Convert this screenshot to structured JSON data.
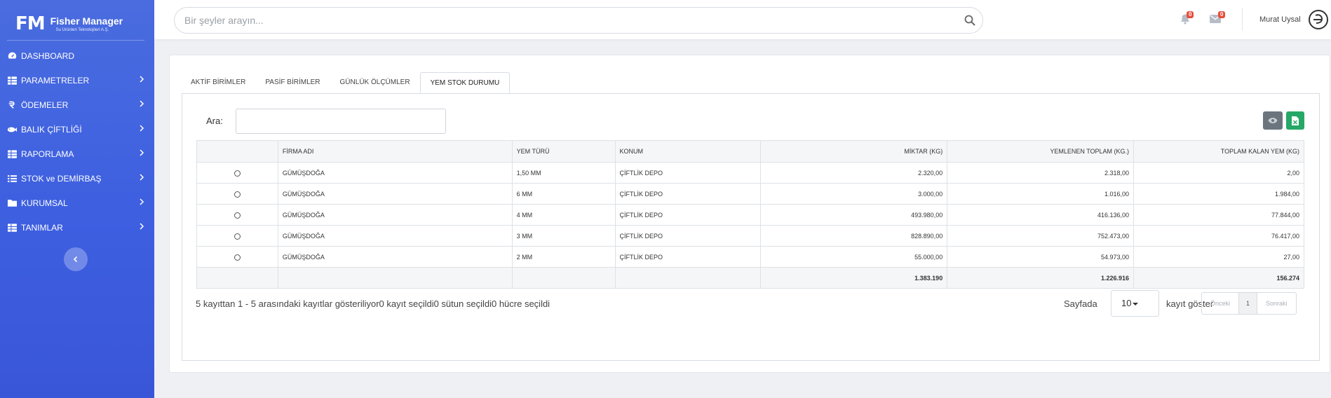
{
  "brand": {
    "logo": "FM",
    "title": "Fisher Manager",
    "subtitle": "Su Ürünleri Teknolojileri A.Ş."
  },
  "sidebar": {
    "items": [
      {
        "label": "DASHBOARD",
        "icon": "dashboard-icon",
        "chevron": false
      },
      {
        "label": "PARAMETRELER",
        "icon": "grid-icon",
        "chevron": true
      },
      {
        "label": "ÖDEMELER",
        "icon": "payment-icon",
        "chevron": true
      },
      {
        "label": "BALIK ÇİFTLİĞİ",
        "icon": "fish-icon",
        "chevron": true
      },
      {
        "label": "RAPORLAMA",
        "icon": "grid-icon",
        "chevron": true
      },
      {
        "label": "STOK ve DEMİRBAŞ",
        "icon": "list-icon",
        "chevron": true
      },
      {
        "label": "KURUMSAL",
        "icon": "folder-icon",
        "chevron": true
      },
      {
        "label": "TANIMLAR",
        "icon": "grid-icon",
        "chevron": true
      }
    ]
  },
  "header": {
    "search_placeholder": "Bir şeyler arayın...",
    "notifications_count": "0",
    "messages_count": "0",
    "username": "Murat Uysal"
  },
  "tabs": [
    "AKTİF BİRİMLER",
    "PASİF BİRİMLER",
    "GÜNLÜK ÖLÇÜMLER",
    "YEM STOK DURUMU"
  ],
  "active_tab": 3,
  "search": {
    "label": "Ara:",
    "value": ""
  },
  "table": {
    "columns": [
      "",
      "FİRMA ADI",
      "YEM TÜRÜ",
      "KONUM",
      "MİKTAR (KG)",
      "YEMLENEN TOPLAM (KG.)",
      "TOPLAM KALAN YEM (KG)"
    ],
    "rows": [
      [
        "GÜMÜŞDOĞA",
        "1,50 MM",
        "ÇİFTLİK DEPO",
        "2.320,00",
        "2.318,00",
        "2,00"
      ],
      [
        "GÜMÜŞDOĞA",
        "6 MM",
        "ÇİFTLİK DEPO",
        "3.000,00",
        "1.016,00",
        "1.984,00"
      ],
      [
        "GÜMÜŞDOĞA",
        "4 MM",
        "ÇİFTLİK DEPO",
        "493.980,00",
        "416.136,00",
        "77.844,00"
      ],
      [
        "GÜMÜŞDOĞA",
        "3 MM",
        "ÇİFTLİK DEPO",
        "828.890,00",
        "752.473,00",
        "76.417,00"
      ],
      [
        "GÜMÜŞDOĞA",
        "2 MM",
        "ÇİFTLİK DEPO",
        "55.000,00",
        "54.973,00",
        "27,00"
      ]
    ],
    "totals": [
      "1.383.190",
      "1.226.916",
      "156.274"
    ]
  },
  "footer": {
    "info": "5 kayıttan 1 - 5 arasındaki kayıtlar gösteriliyor0 kayıt seçildi0 sütun seçildi0 hücre seçildi",
    "page_label": "Sayfada",
    "page_size": "10",
    "show_label": "kayıt göster",
    "prev": "Önceki",
    "current_page": "1",
    "next": "Sonraki"
  }
}
